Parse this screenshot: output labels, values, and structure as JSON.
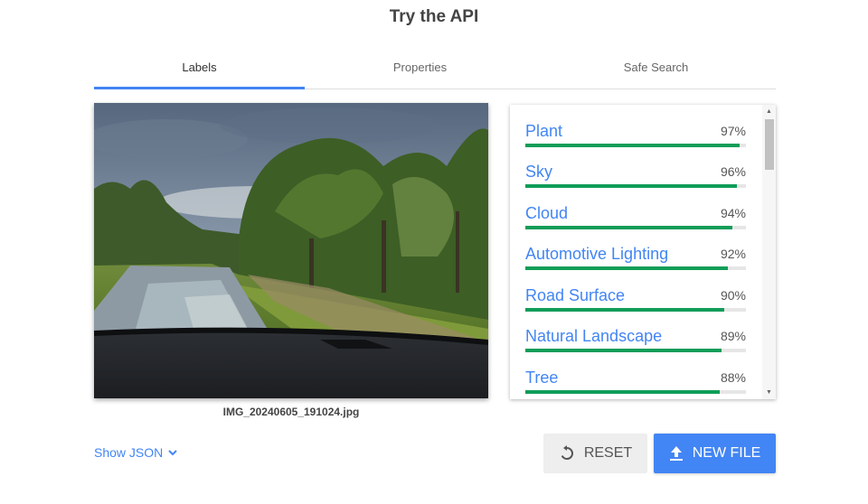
{
  "header": {
    "title": "Try the API"
  },
  "tabs": [
    {
      "label": "Labels",
      "active": true
    },
    {
      "label": "Properties",
      "active": false
    },
    {
      "label": "Safe Search",
      "active": false
    }
  ],
  "image": {
    "filename": "IMG_20240605_191024.jpg"
  },
  "labels": [
    {
      "name": "Plant",
      "score_text": "97%",
      "score": 0.97
    },
    {
      "name": "Sky",
      "score_text": "96%",
      "score": 0.96
    },
    {
      "name": "Cloud",
      "score_text": "94%",
      "score": 0.94
    },
    {
      "name": "Automotive Lighting",
      "score_text": "92%",
      "score": 0.92
    },
    {
      "name": "Road Surface",
      "score_text": "90%",
      "score": 0.9
    },
    {
      "name": "Natural Landscape",
      "score_text": "89%",
      "score": 0.89
    },
    {
      "name": "Tree",
      "score_text": "88%",
      "score": 0.88
    }
  ],
  "footer": {
    "show_json_label": "Show JSON",
    "reset_label": "RESET",
    "new_file_label": "NEW FILE"
  },
  "colors": {
    "accent": "#4285f4",
    "bar": "#0f9d58"
  },
  "icons": {
    "expand": "chevron-down-icon",
    "reset": "reset-icon",
    "upload": "upload-icon",
    "scroll_up": "scroll-up-arrow-icon",
    "scroll_down": "scroll-down-arrow-icon"
  }
}
